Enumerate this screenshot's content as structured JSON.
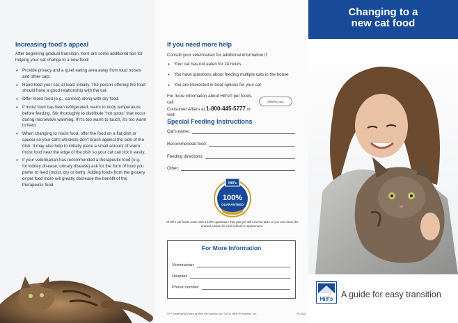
{
  "panel1": {
    "heading": "Increasing food's appeal",
    "intro": "After beginning gradual transition, here are some additional tips for helping your cat change to a new food:",
    "tips": [
      "Provide privacy and a quiet eating area away from loud noises and other cats.",
      "Hand-feed your cat, at least initially. The person offering the food should have a good relationship with the cat.",
      "Offer moist food (e.g., canned) along with dry food.",
      "If moist food has been refrigerated, warm to body temperature before feeding. Stir thoroughly to distribute \"hot spots\" that occur during microwave warming. If it's too warm to touch, it's too warm to feed.",
      "When changing to moist food, offer the food on a flat dish or saucer so your cat's whiskers don't brush against the side of the dish. It may also help to initially place a small amount of warm moist food near the edge of the dish so your cat can lick it easily.",
      "If your veterinarian has recommended a therapeutic food (e.g., for kidney disease, urinary disease) ask for the form of food you prefer to feed (moist, dry or both). Adding foods from the grocery or pet food store will greatly decrease the benefit of the therapeutic food."
    ]
  },
  "panel2": {
    "help_heading": "If you need more help",
    "help_intro": "Consult your veterinarian for additional information if:",
    "help_items": [
      "Your cat has not eaten for 24 hours",
      "You have questions about feeding multiple cats in the house",
      "You are interested in treat options for your cat"
    ],
    "contact_text_1": "For more information about Hill's® pet foods, call",
    "contact_text_2": "Consumer Affairs at",
    "phone": "1-800-445-5777",
    "contact_text_3": "or visit",
    "website": "HillsPet.com",
    "feeding_heading": "Special Feeding Instructions",
    "feeding_fields": [
      "Cat's name:",
      "Recommended food:",
      "Feeding directions:",
      "Other:"
    ],
    "badge_pct": "100%",
    "badge_word": "GUARANTEED",
    "badge_brand": "Hill's",
    "guarantee_text": "All Hill's pet foods come with a 100% guarantee that your pet will love the taste or you can return the unused portion for a full refund or replacement.",
    "info_heading": "For More Information",
    "info_fields": [
      "Veterinarian:",
      "Hospital:",
      "Phone number:"
    ],
    "footer_left": "®/™ Trademarks owned by Hill's Pet Nutrition, Inc. ©2011 Hill's Pet Nutrition, Inc.",
    "footer_right": "¹²D-2012"
  },
  "panel3": {
    "title_line1": "Changing to a",
    "title_line2": "new cat food",
    "tagline": "A guide for easy transition",
    "logo_text": "Hill's"
  },
  "colors": {
    "brand_blue": "#174a98",
    "heading_blue": "#1a4f9a"
  }
}
